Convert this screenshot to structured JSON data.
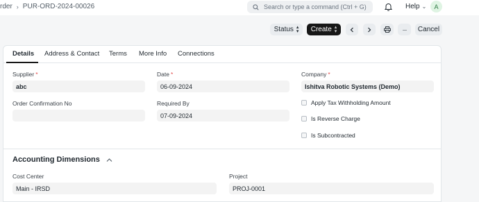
{
  "breadcrumb": {
    "parent": "rder",
    "separator": "›",
    "current": "PUR-ORD-2024-00026"
  },
  "search": {
    "placeholder": "Search or type a command (Ctrl + G)"
  },
  "topnav": {
    "help_label": "Help",
    "avatar_letter": "A"
  },
  "toolbar": {
    "status_label": "Status",
    "create_label": "Create",
    "cancel_label": "Cancel",
    "more_label": "···"
  },
  "tabs": [
    "Details",
    "Address & Contact",
    "Terms",
    "More Info",
    "Connections"
  ],
  "form": {
    "supplier": {
      "label": "Supplier",
      "required": "*",
      "value": "abc"
    },
    "date": {
      "label": "Date",
      "required": "*",
      "value": "06-09-2024"
    },
    "company": {
      "label": "Company",
      "required": "*",
      "value": "Ishitva Robotic Systems (Demo)"
    },
    "order_confirmation_no": {
      "label": "Order Confirmation No",
      "value": ""
    },
    "required_by": {
      "label": "Required By",
      "value": "07-09-2024"
    },
    "checkboxes": [
      "Apply Tax Withholding Amount",
      "Is Reverse Charge",
      "Is Subcontracted"
    ]
  },
  "accounting": {
    "title": "Accounting Dimensions",
    "cost_center": {
      "label": "Cost Center",
      "value": "Main - IRSD"
    },
    "project": {
      "label": "Project",
      "value": "PROJ-0001"
    }
  }
}
